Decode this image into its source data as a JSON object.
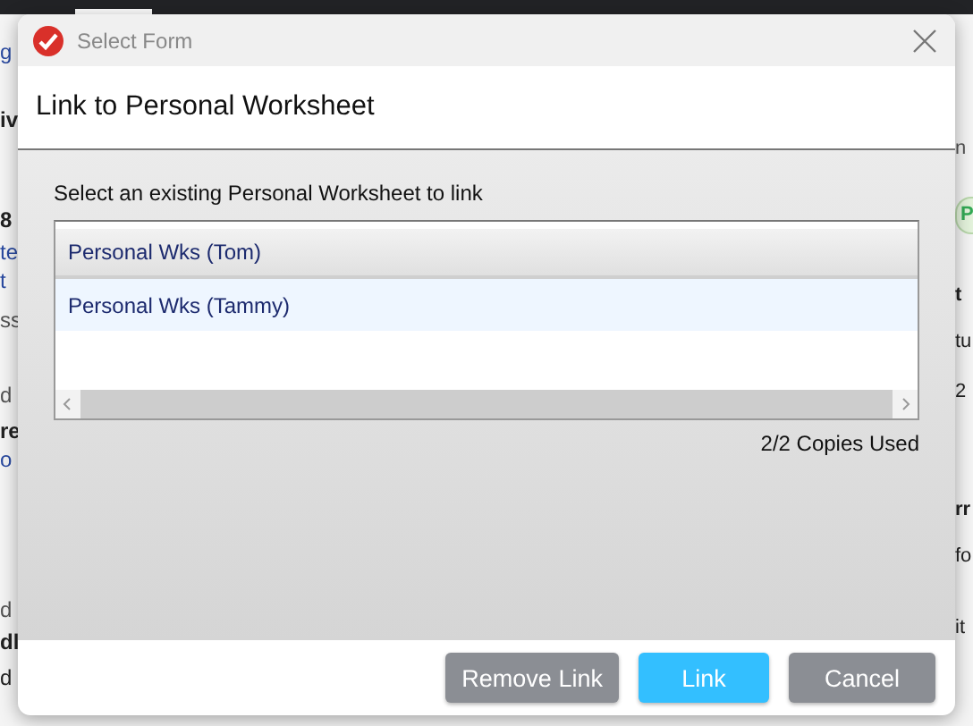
{
  "background": {
    "left_fragments": [
      "g",
      "iv",
      "8",
      "te",
      "t",
      "ss",
      "d",
      "re",
      "o",
      "d",
      "dl",
      "d"
    ],
    "right_fragments": [
      "n",
      "P",
      "t",
      "tu",
      "2",
      "rr",
      "fo",
      "it"
    ]
  },
  "dialog": {
    "title": "Select Form",
    "heading": "Link to Personal Worksheet",
    "instruction": "Select an existing Personal Worksheet to link",
    "worksheets": [
      {
        "name": "Personal Wks (Tom)",
        "selected": true
      },
      {
        "name": "Personal Wks (Tammy)",
        "selected": false
      }
    ],
    "copies": "2/2 Copies Used",
    "buttons": [
      {
        "label": "Remove Link",
        "kind": "secondary"
      },
      {
        "label": "Link",
        "kind": "primary"
      },
      {
        "label": "Cancel",
        "kind": "secondary"
      }
    ]
  }
}
